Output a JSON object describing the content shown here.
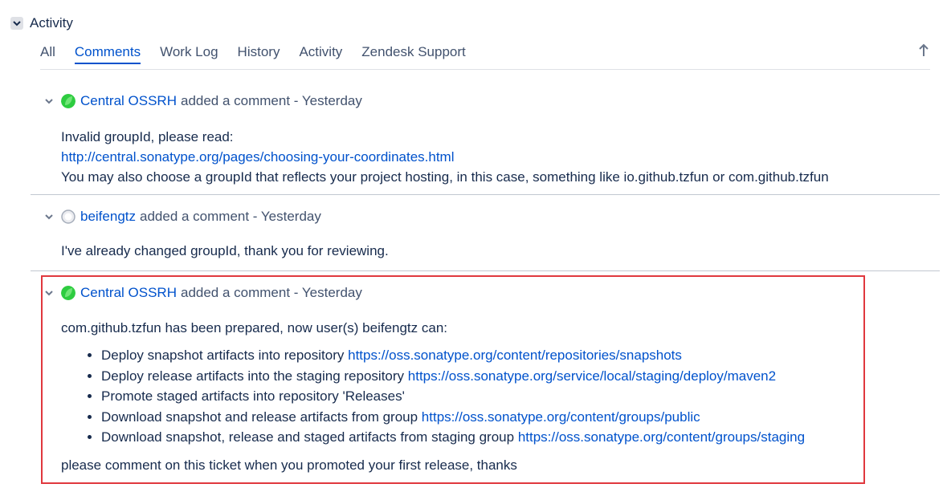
{
  "section": {
    "title": "Activity"
  },
  "tabs": [
    {
      "label": "All",
      "active": false
    },
    {
      "label": "Comments",
      "active": true
    },
    {
      "label": "Work Log",
      "active": false
    },
    {
      "label": "History",
      "active": false
    },
    {
      "label": "Activity",
      "active": false
    },
    {
      "label": "Zendesk Support",
      "active": false
    }
  ],
  "comments": [
    {
      "author": "Central OSSRH",
      "action": "added a comment - Yesterday",
      "avatar": "green-leaf-avatar",
      "line1": "Invalid groupId, please read:",
      "link": "http://central.sonatype.org/pages/choosing-your-coordinates.html",
      "line3": "You may also choose a groupId that reflects your project hosting, in this case, something like io.github.tzfun or com.github.tzfun"
    },
    {
      "author": "beifengtz",
      "action": "added a comment - Yesterday",
      "avatar": "default-avatar",
      "line1": "I've already changed groupId, thank you for reviewing."
    },
    {
      "author": "Central OSSRH",
      "action": "added a comment - Yesterday",
      "avatar": "green-leaf-avatar",
      "intro": "com.github.tzfun has been prepared, now user(s) beifengtz can:",
      "items": [
        {
          "text": "Deploy snapshot artifacts into repository",
          "link": "https://oss.sonatype.org/content/repositories/snapshots"
        },
        {
          "text": "Deploy release artifacts into the staging repository",
          "link": "https://oss.sonatype.org/service/local/staging/deploy/maven2"
        },
        {
          "text": "Promote staged artifacts into repository 'Releases'",
          "link": ""
        },
        {
          "text": "Download snapshot and release artifacts from group",
          "link": "https://oss.sonatype.org/content/groups/public"
        },
        {
          "text": "Download snapshot, release and staged artifacts from staging group",
          "link": "https://oss.sonatype.org/content/groups/staging"
        }
      ],
      "outro": "please comment on this ticket when you promoted your first release, thanks"
    }
  ],
  "colors": {
    "link": "#0052cc",
    "text": "#172b4d",
    "highlight": "#e0383e"
  }
}
